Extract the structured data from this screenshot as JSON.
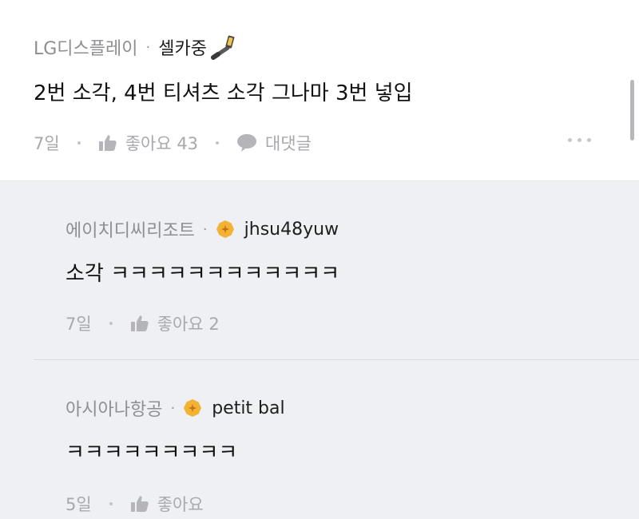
{
  "top_comment": {
    "company": "LG디스플레이",
    "separator": "·",
    "nickname": "셀카중",
    "nickname_icon": "selfie-stick-icon",
    "text": "2번 소각, 4번 티셔츠 소각 그나마 3번 넣입",
    "time": "7일",
    "like_label": "좋아요 43",
    "reply_label": "대댓글"
  },
  "replies": [
    {
      "company": "에이치디씨리조트",
      "separator": "·",
      "nickname": "jhsu48yuw",
      "text": "소각 ㅋㅋㅋㅋㅋㅋㅋㅋㅋㅋㅋㅋ",
      "time": "7일",
      "like_label": "좋아요 2"
    },
    {
      "company": "아시아나항공",
      "separator": "·",
      "nickname": "petit bal",
      "text": "ㅋㅋㅋㅋㅋㅋㅋㅋㅋ",
      "time": "5일",
      "like_label": "좋아요"
    }
  ],
  "colors": {
    "reply_background": "#eef0f3",
    "badge": "#f2b233",
    "meta_text": "#a8a8ad"
  }
}
